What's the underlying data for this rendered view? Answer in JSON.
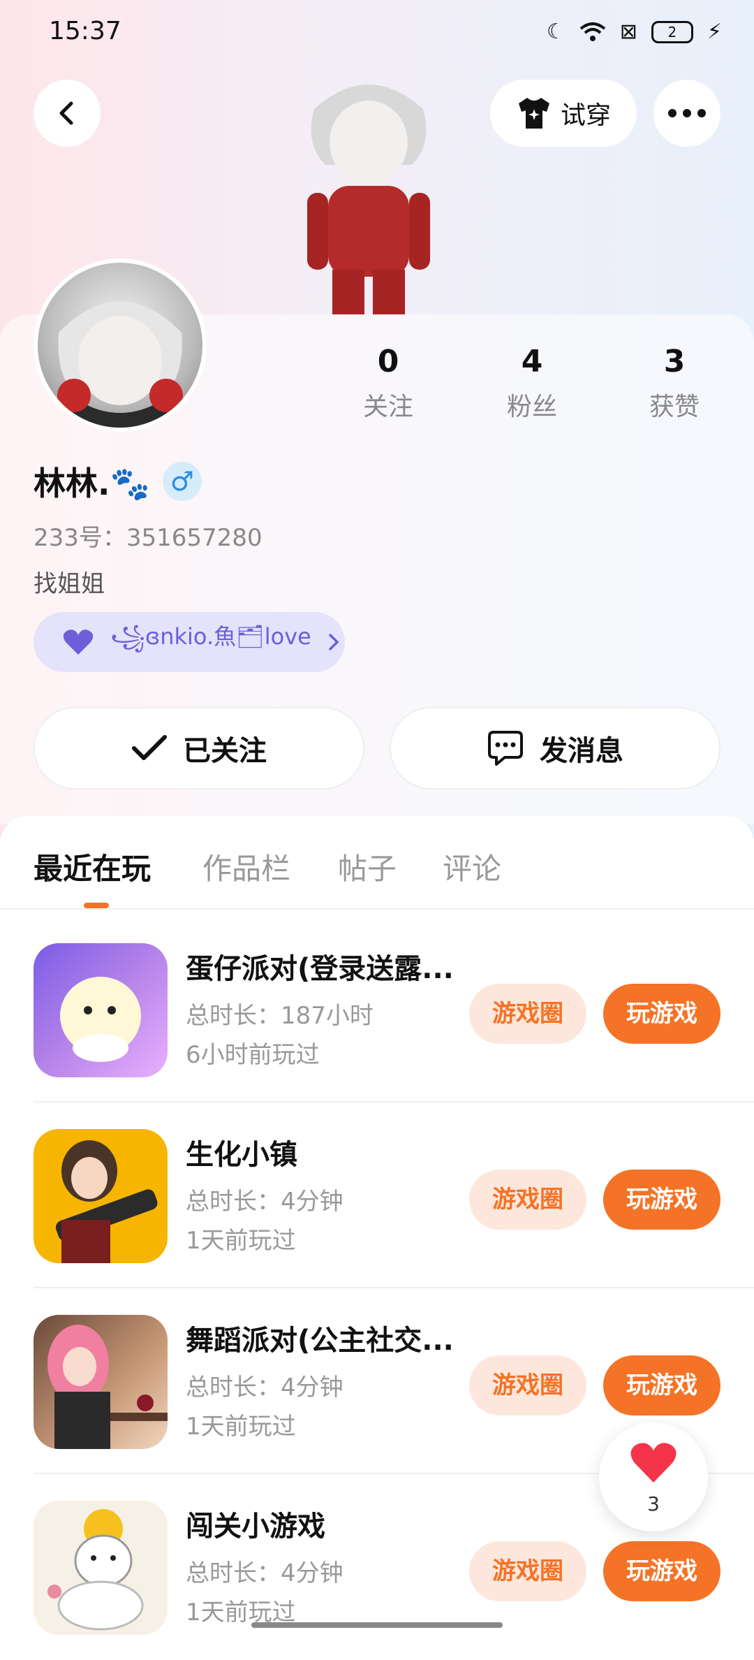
{
  "status": {
    "time": "15:37",
    "battery": "2"
  },
  "header": {
    "tryon_label": "试穿"
  },
  "profile": {
    "name": "林林.🐾",
    "gender_symbol": "♂",
    "uid": "233号：351657280",
    "bio": "找姐姐",
    "relation_tag": "꧁ɞnkio.魚🗂love"
  },
  "stats": [
    {
      "value": "0",
      "label": "关注"
    },
    {
      "value": "4",
      "label": "粉丝"
    },
    {
      "value": "3",
      "label": "获赞"
    }
  ],
  "actions": {
    "follow": "已关注",
    "message": "发消息"
  },
  "tabs": [
    "最近在玩",
    "作品栏",
    "帖子",
    "评论"
  ],
  "games": [
    {
      "title": "蛋仔派对(登录送露...",
      "duration": "总时长：187小时",
      "last_played": "6小时前玩过",
      "circle_label": "游戏圈",
      "play_label": "玩游戏"
    },
    {
      "title": "生化小镇",
      "duration": "总时长：4分钟",
      "last_played": "1天前玩过",
      "circle_label": "游戏圈",
      "play_label": "玩游戏"
    },
    {
      "title": "舞蹈派对(公主社交...",
      "duration": "总时长：4分钟",
      "last_played": "1天前玩过",
      "circle_label": "游戏圈",
      "play_label": "玩游戏"
    },
    {
      "title": "闯关小游戏",
      "duration": "总时长：4分钟",
      "last_played": "1天前玩过",
      "circle_label": "游戏圈",
      "play_label": "玩游戏"
    }
  ],
  "like_fab": {
    "count": "3"
  },
  "colors": {
    "accent": "#f47326",
    "accent_light": "#fde7dc",
    "tag_bg": "#e5e2fb",
    "tag_text": "#6d5ed9"
  }
}
